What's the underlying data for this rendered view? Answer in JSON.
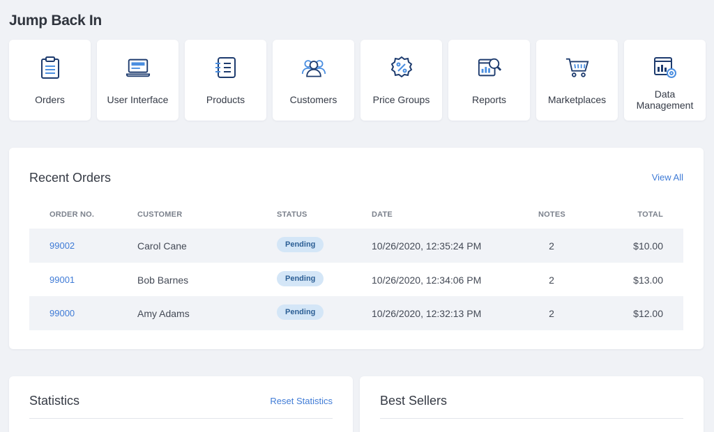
{
  "page": {
    "title": "Jump Back In"
  },
  "tiles": [
    {
      "label": "Orders",
      "icon": "clipboard-icon"
    },
    {
      "label": "User Interface",
      "icon": "laptop-icon"
    },
    {
      "label": "Products",
      "icon": "list-document-icon"
    },
    {
      "label": "Customers",
      "icon": "users-icon"
    },
    {
      "label": "Price Groups",
      "icon": "percent-badge-icon"
    },
    {
      "label": "Reports",
      "icon": "report-magnifier-icon"
    },
    {
      "label": "Marketplaces",
      "icon": "shopping-cart-icon"
    },
    {
      "label": "Data Management",
      "icon": "data-settings-icon"
    }
  ],
  "recent_orders": {
    "title": "Recent Orders",
    "view_all": "View All",
    "columns": {
      "order": "ORDER NO.",
      "customer": "CUSTOMER",
      "status": "STATUS",
      "date": "DATE",
      "notes": "NOTES",
      "total": "TOTAL"
    },
    "rows": [
      {
        "order": "99002",
        "customer": "Carol Cane",
        "status": "Pending",
        "date": "10/26/2020, 12:35:24 PM",
        "notes": "2",
        "total": "$10.00"
      },
      {
        "order": "99001",
        "customer": "Bob Barnes",
        "status": "Pending",
        "date": "10/26/2020, 12:34:06 PM",
        "notes": "2",
        "total": "$13.00"
      },
      {
        "order": "99000",
        "customer": "Amy Adams",
        "status": "Pending",
        "date": "10/26/2020, 12:32:13 PM",
        "notes": "2",
        "total": "$12.00"
      }
    ]
  },
  "statistics": {
    "title": "Statistics",
    "reset": "Reset Statistics"
  },
  "best_sellers": {
    "title": "Best Sellers"
  },
  "colors": {
    "accent": "#3f7bd6",
    "icon_dark": "#1d3b6e",
    "icon_light": "#4a8ee0",
    "badge_bg": "#d4e6f7"
  }
}
